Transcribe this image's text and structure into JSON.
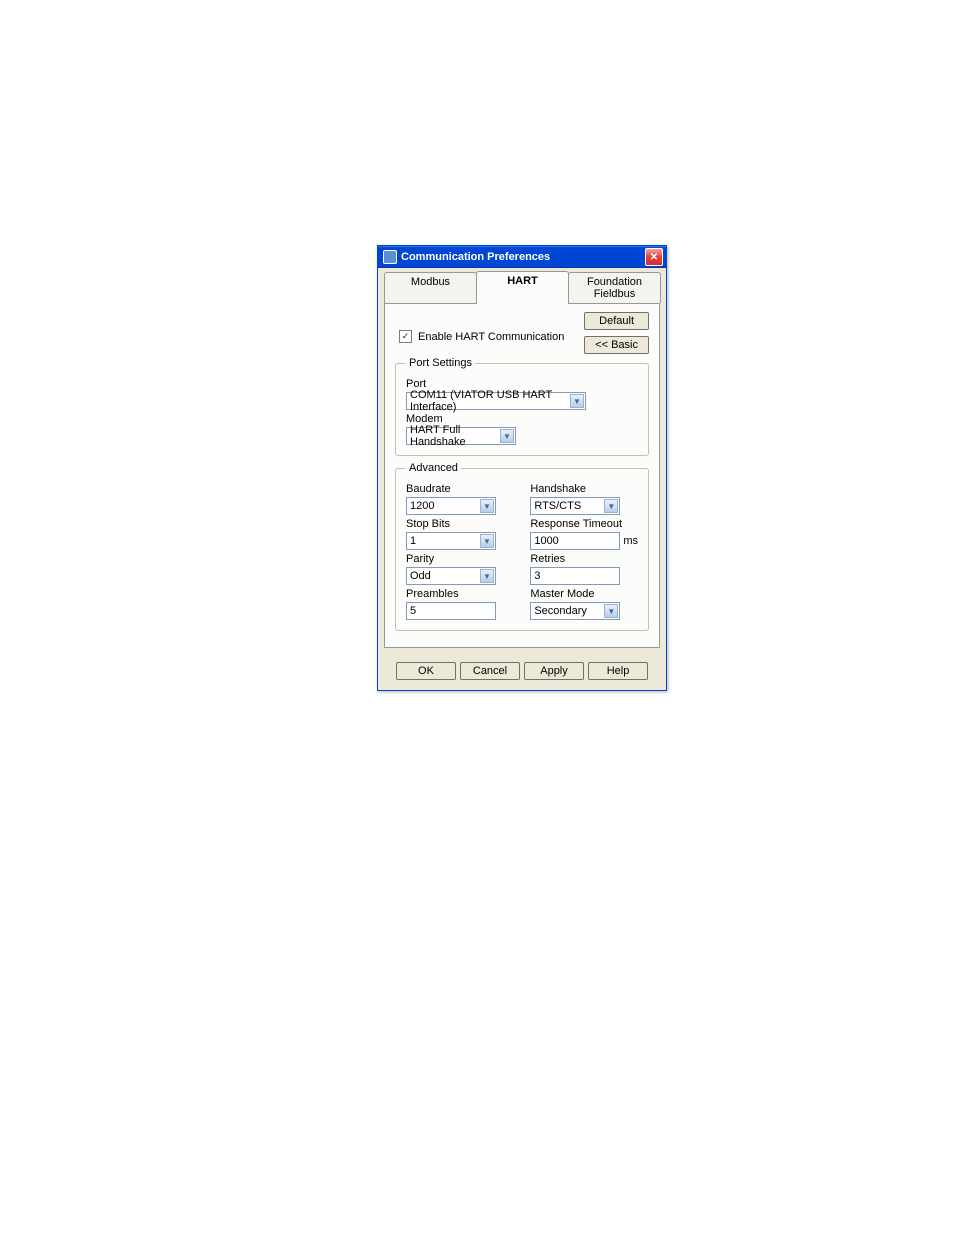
{
  "window": {
    "title": "Communication Preferences"
  },
  "tabs": {
    "modbus": "Modbus",
    "hart": "HART",
    "ff": "Foundation Fieldbus"
  },
  "side_buttons": {
    "default": "Default",
    "basic": "<< Basic"
  },
  "enable": {
    "label": "Enable HART Communication",
    "checked": "✓"
  },
  "port_settings": {
    "legend": "Port Settings",
    "port_label": "Port",
    "port_value": "COM11 (VIATOR USB HART Interface)",
    "modem_label": "Modem",
    "modem_value": "HART Full Handshake"
  },
  "advanced": {
    "legend": "Advanced",
    "baudrate_label": "Baudrate",
    "baudrate_value": "1200",
    "stopbits_label": "Stop Bits",
    "stopbits_value": "1",
    "parity_label": "Parity",
    "parity_value": "Odd",
    "preambles_label": "Preambles",
    "preambles_value": "5",
    "handshake_label": "Handshake",
    "handshake_value": "RTS/CTS",
    "timeout_label": "Response Timeout",
    "timeout_value": "1000",
    "timeout_unit": "ms",
    "retries_label": "Retries",
    "retries_value": "3",
    "master_label": "Master Mode",
    "master_value": "Secondary"
  },
  "buttons": {
    "ok": "OK",
    "cancel": "Cancel",
    "apply": "Apply",
    "help": "Help"
  }
}
